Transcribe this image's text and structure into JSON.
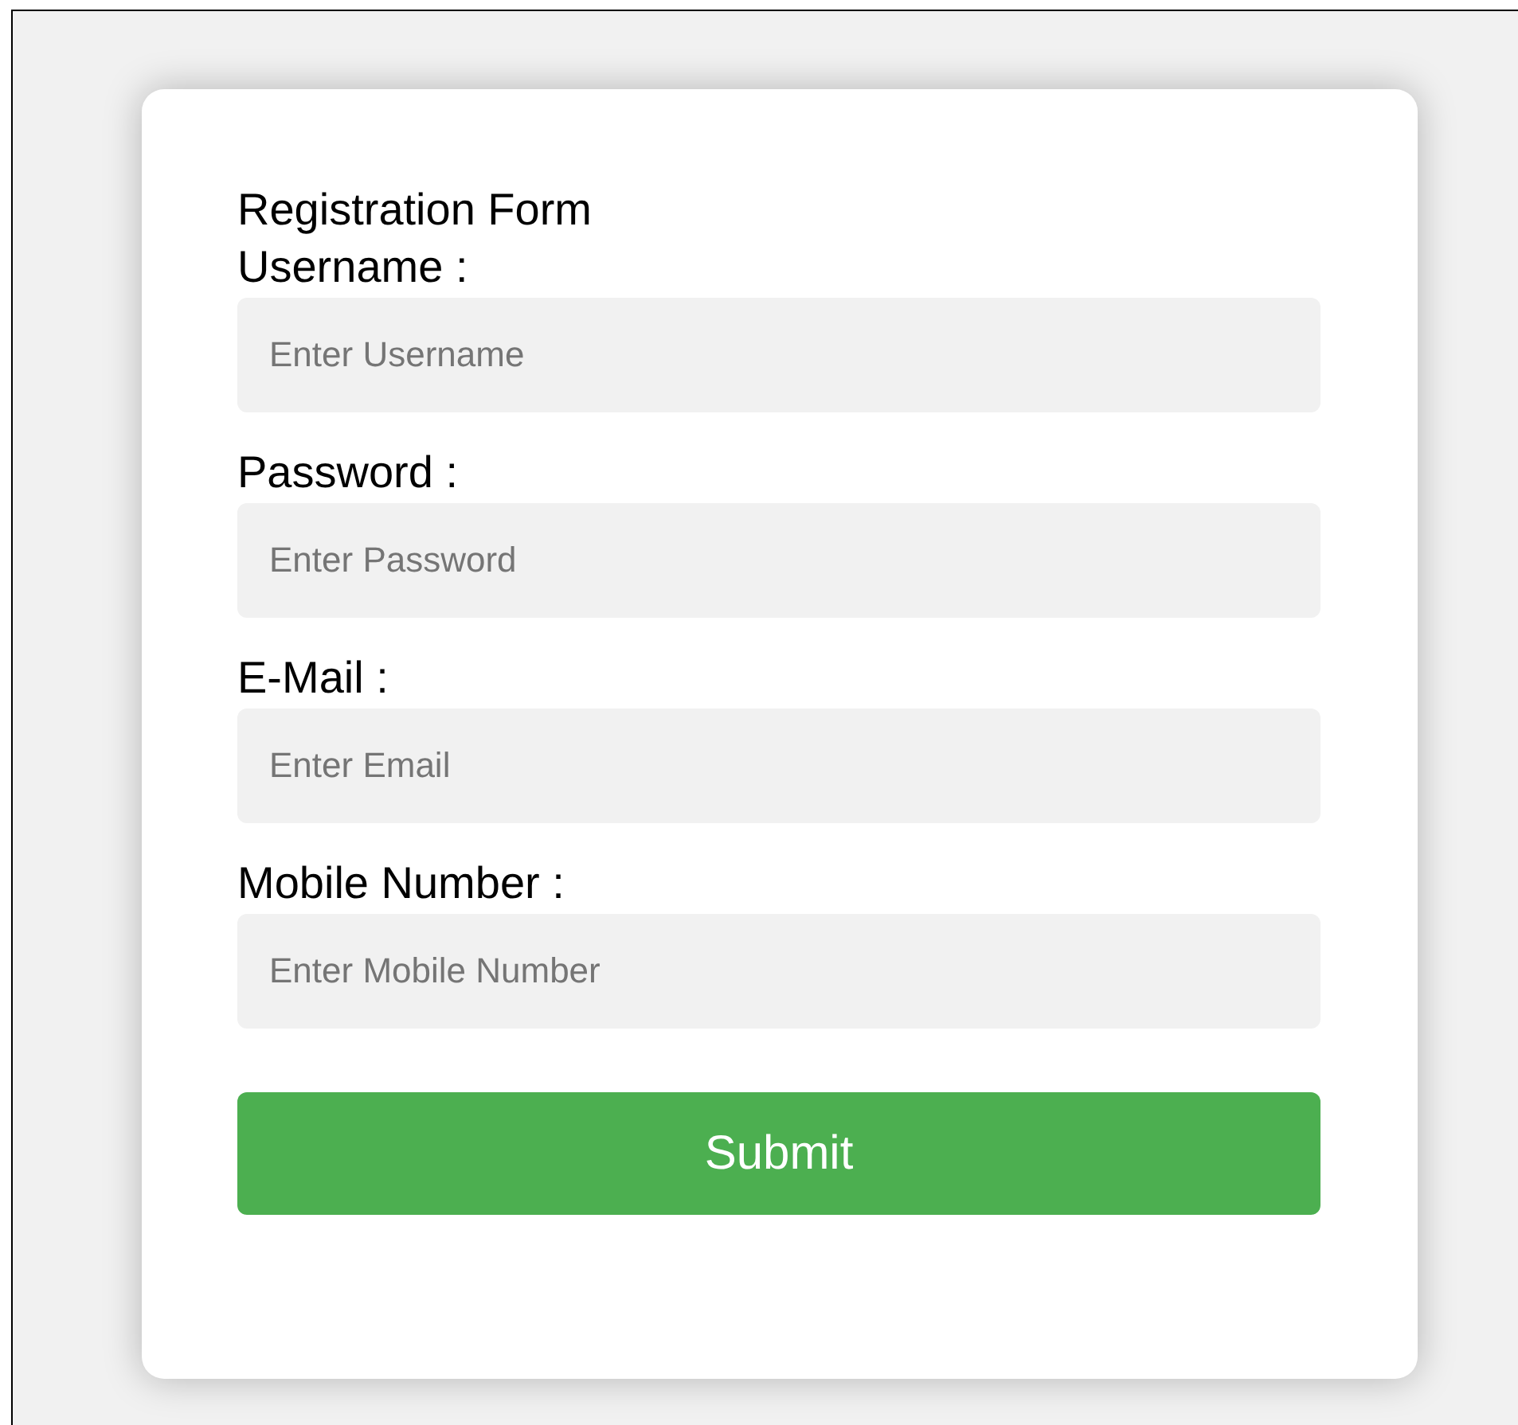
{
  "form": {
    "title": "Registration Form",
    "fields": [
      {
        "label": "Username :",
        "placeholder": "Enter Username"
      },
      {
        "label": "Password :",
        "placeholder": "Enter Password"
      },
      {
        "label": "E-Mail :",
        "placeholder": "Enter Email"
      },
      {
        "label": "Mobile Number :",
        "placeholder": "Enter Mobile Number"
      }
    ],
    "submit": "Submit"
  }
}
